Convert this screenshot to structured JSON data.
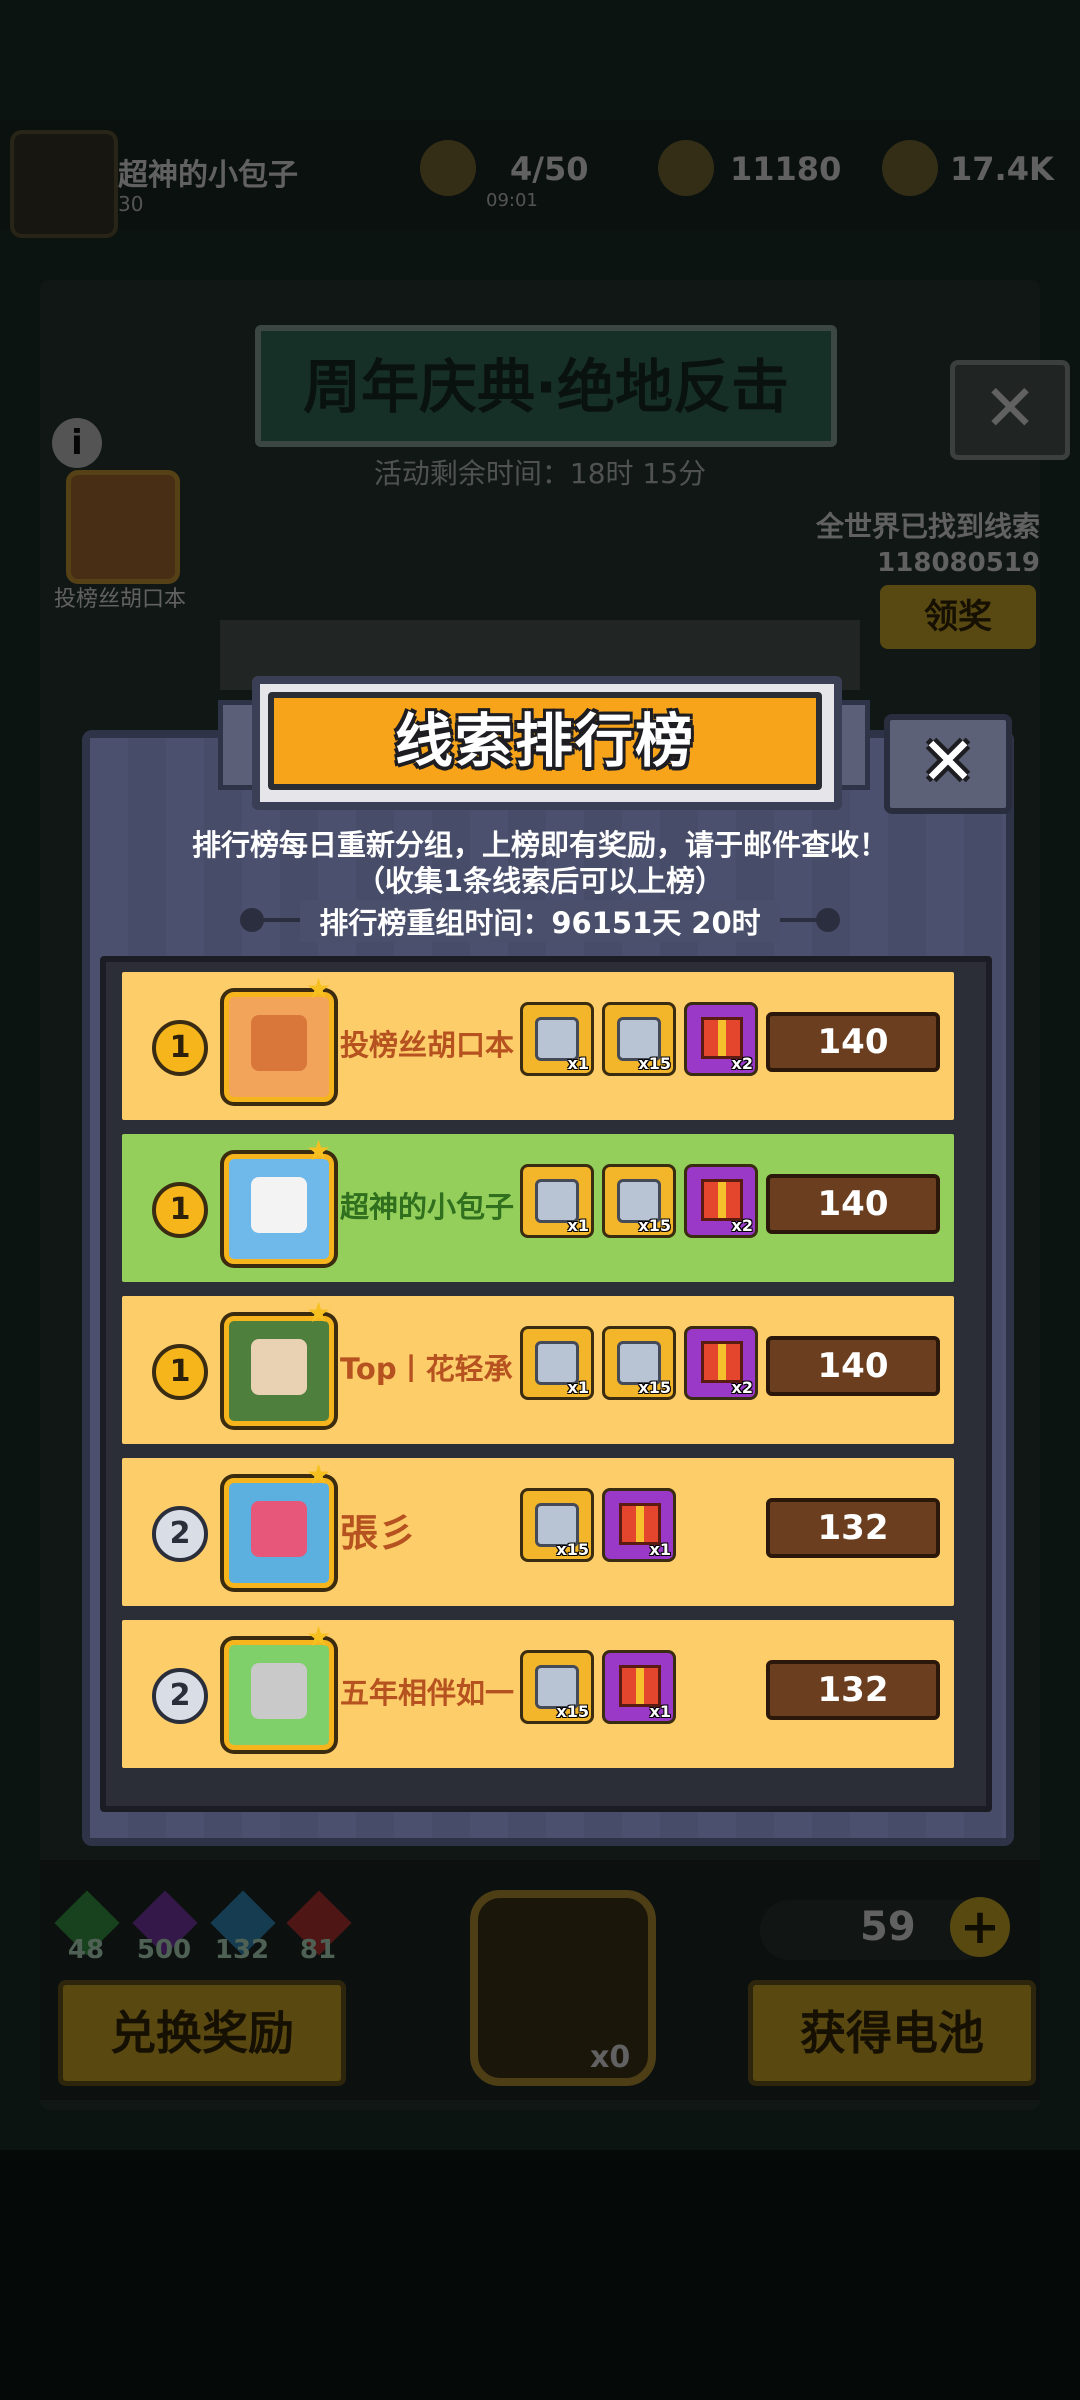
{
  "background": {
    "player_name": "超神的小包子",
    "player_sub": "30",
    "stat_clues": "4/50",
    "stat_clues_time": "09:01",
    "stat_gold": "11180",
    "stat_coins": "17.4K",
    "event_title": "周年庆典·绝地反击",
    "event_time": "活动剩余时间：18时 15分",
    "info_icon": "i",
    "top_player_name": "投榜丝胡口本",
    "world_label": "全世界已找到线索",
    "world_count": "118080519",
    "claim_button": "领奖",
    "gems": [
      {
        "count": "48",
        "color": "#3fae4d"
      },
      {
        "count": "500",
        "color": "#8a3fc2"
      },
      {
        "count": "132",
        "color": "#3a9fd8"
      },
      {
        "count": "81",
        "color": "#d03a3a"
      }
    ],
    "lock_count": "x0",
    "battery_count": "59",
    "plus_label": "+",
    "exchange_button": "兑换奖励",
    "get_battery_button": "获得电池"
  },
  "modal": {
    "title": "线索排行榜",
    "close_label": "✕",
    "desc_line1": "排行榜每日重新分组，上榜即有奖励，请于邮件查收！",
    "desc_line2": "（收集1条线索后可以上榜）",
    "reset_time": "排行榜重组时间：96151天 20时",
    "rows": [
      {
        "rank": "1",
        "rank_type": "gold",
        "name": "投榜丝胡口本",
        "name_color": "#b5521f",
        "bg": "#fdcd6a",
        "avatar_color": "#d9763a",
        "avatar_bg": "#f2a45b",
        "rewards": [
          {
            "type": "gold",
            "qty": "x1"
          },
          {
            "type": "gold",
            "qty": "x15"
          },
          {
            "type": "purple",
            "qty": "x2"
          }
        ],
        "score": "140"
      },
      {
        "rank": "1",
        "rank_type": "gold",
        "name": "超神的小包子",
        "name_color": "#2f6f1e",
        "bg": "#93cf5a",
        "avatar_color": "#f3f3f3",
        "avatar_bg": "#6fb9ea",
        "rewards": [
          {
            "type": "gold",
            "qty": "x1"
          },
          {
            "type": "gold",
            "qty": "x15"
          },
          {
            "type": "purple",
            "qty": "x2"
          }
        ],
        "score": "140"
      },
      {
        "rank": "1",
        "rank_type": "gold",
        "name": "Top丨花轻承",
        "name_color": "#b5521f",
        "bg": "#fdcd6a",
        "avatar_color": "#e9d2b3",
        "avatar_bg": "#4f7f3c",
        "rewards": [
          {
            "type": "gold",
            "qty": "x1"
          },
          {
            "type": "gold",
            "qty": "x15"
          },
          {
            "type": "purple",
            "qty": "x2"
          }
        ],
        "score": "140"
      },
      {
        "rank": "2",
        "rank_type": "silver",
        "name": "張彡",
        "name_color": "#b5521f",
        "bg": "#fdcd6a",
        "avatar_color": "#e6577a",
        "avatar_bg": "#5bb0e0",
        "rewards": [
          {
            "type": "gold",
            "qty": "x15"
          },
          {
            "type": "purple",
            "qty": "x1"
          }
        ],
        "score": "132"
      },
      {
        "rank": "2",
        "rank_type": "silver",
        "name": "五年相伴如一",
        "name_color": "#b5521f",
        "bg": "#fdcd6a",
        "avatar_color": "#c9c9c9",
        "avatar_bg": "#7fd06b",
        "rewards": [
          {
            "type": "gold",
            "qty": "x15"
          },
          {
            "type": "purple",
            "qty": "x1"
          }
        ],
        "score": "132"
      }
    ]
  },
  "colors": {
    "title_orange": "#f7a41a",
    "modal_bg": "#4a4f6c",
    "score_brown": "#6b3e1f",
    "row_yellow": "#fdcd6a",
    "row_green": "#93cf5a"
  }
}
